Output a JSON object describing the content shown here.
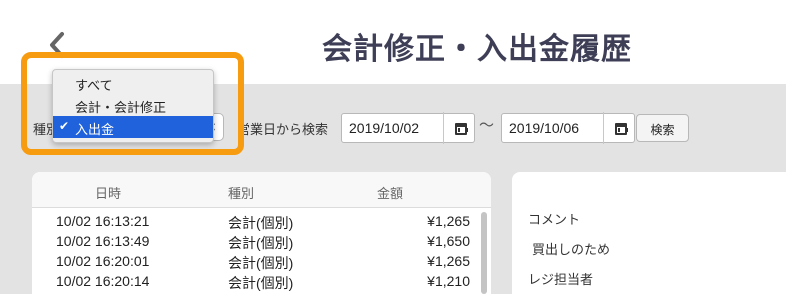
{
  "header": {
    "title": "会計修正・入出金履歴",
    "back_icon": "chevron-left-icon"
  },
  "filter": {
    "type_label": "種別",
    "type_selected": "入出金",
    "type_options": [
      "すべて",
      "会計・会計修正",
      "入出金"
    ],
    "date_search_label": "営業日から検索",
    "date_from": "2019/10/02",
    "date_separator": "〜",
    "date_to": "2019/10/06",
    "search_button": "検索"
  },
  "colors": {
    "highlight": "#f79b11",
    "selection": "#1f62dc",
    "title": "#3e3f56"
  },
  "table": {
    "columns": [
      "日時",
      "種別",
      "金額"
    ],
    "rows": [
      {
        "datetime": "10/02 16:13:21",
        "type": "会計(個別)",
        "amount": "¥1,265"
      },
      {
        "datetime": "10/02 16:13:49",
        "type": "会計(個別)",
        "amount": "¥1,650"
      },
      {
        "datetime": "10/02 16:20:01",
        "type": "会計(個別)",
        "amount": "¥1,265"
      },
      {
        "datetime": "10/02 16:20:14",
        "type": "会計(個別)",
        "amount": "¥1,210"
      }
    ]
  },
  "detail": {
    "comment_label": "コメント",
    "comment_value": "買出しのため",
    "staff_label": "レジ担当者"
  }
}
